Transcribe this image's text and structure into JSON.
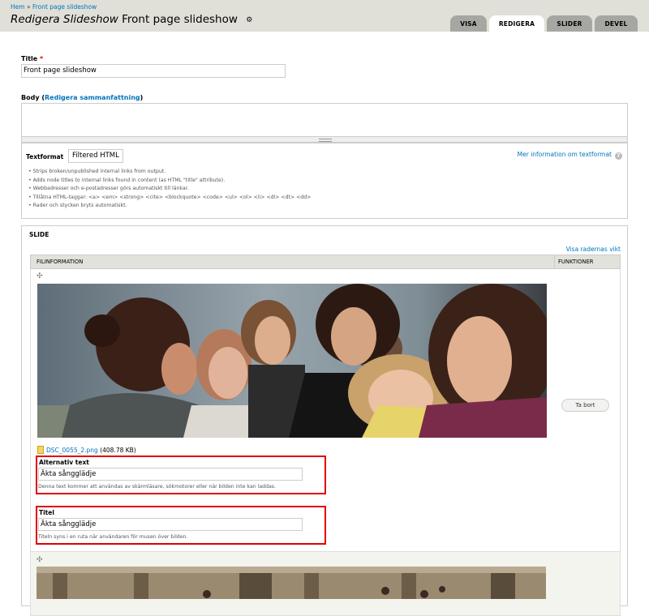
{
  "breadcrumb": {
    "home": "Hem",
    "separator": "»",
    "current": "Front page slideshow"
  },
  "page": {
    "title_prefix": "Redigera Slideshow",
    "title": "Front page slideshow",
    "gear": "⚙"
  },
  "tabs": [
    {
      "label": "VISA",
      "active": false
    },
    {
      "label": "REDIGERA",
      "active": true
    },
    {
      "label": "SLIDER",
      "active": false
    },
    {
      "label": "DEVEL",
      "active": false
    }
  ],
  "title_field": {
    "label": "Title",
    "required": "*",
    "value": "Front page slideshow"
  },
  "body_field": {
    "label": "Body",
    "summary_link": "Redigera sammanfattning",
    "open_paren": "(",
    "close_paren": ")"
  },
  "text_format": {
    "label": "Textformat",
    "selected": "Filtered HTML",
    "more_info": "Mer information om textformat",
    "help": "?",
    "tips": [
      "Strips broken/unpublished internal links from output.",
      "Adds node titles to internal links found in content (as HTML \"title\" attribute).",
      "Webbadresser och e-postadresser görs automatiskt till länkar.",
      "Tillåtna HTML-taggar: <a> <em> <strong> <cite> <blockquote> <code> <ul> <ol> <li> <dl> <dt> <dd>",
      "Rader och stycken bryts automatiskt."
    ]
  },
  "slide": {
    "legend": "SLIDE",
    "show_weights": "Visa radernas vikt",
    "columns": {
      "file_info": "FILINFORMATION",
      "functions": "FUNKTIONER"
    },
    "drag_icon": "✣",
    "items": [
      {
        "file_name": "DSC_0055_2.png",
        "file_size": "(408.78 KB)",
        "remove_label": "Ta bort",
        "alt": {
          "label": "Alternativ text",
          "value": "Äkta sångglädje",
          "description": "Denna text kommer att användas av skärmläsare, sökmotorer eller när bilden inte kan laddas."
        },
        "title": {
          "label": "Titel",
          "value": "Äkta sångglädje",
          "description": "Titeln syns i en ruta när användaren för musen över bilden."
        }
      }
    ]
  },
  "colors": {
    "link": "#0074bd",
    "header_bg": "#e0e0d8",
    "tab_bg": "#a6a7a2",
    "highlight_box": "#e00000"
  }
}
